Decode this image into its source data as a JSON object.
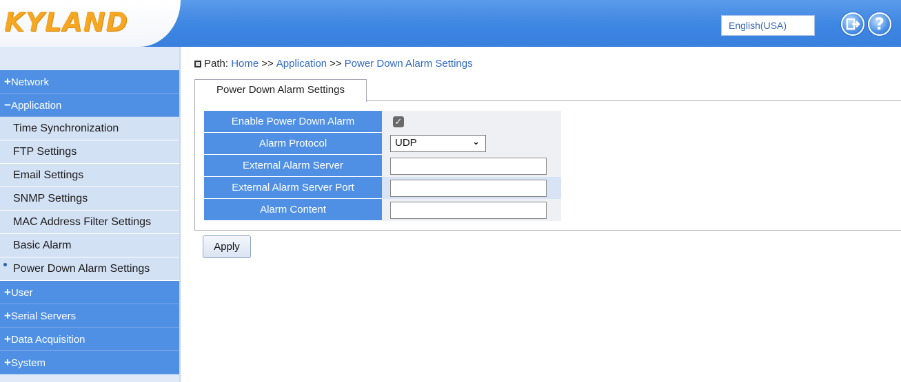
{
  "header": {
    "logo_text": "KYLAND",
    "language": "English(USA)",
    "colors": {
      "header_blue": "#3d86e2",
      "logo_orange": "#f5a623"
    }
  },
  "sidebar": {
    "items": [
      {
        "sign": "+",
        "label": "Network",
        "level": "top"
      },
      {
        "sign": "−",
        "label": "Application",
        "level": "top"
      },
      {
        "label": "Time Synchronization",
        "level": "sub"
      },
      {
        "label": "FTP Settings",
        "level": "sub"
      },
      {
        "label": "Email Settings",
        "level": "sub"
      },
      {
        "label": "SNMP Settings",
        "level": "sub"
      },
      {
        "label": "MAC Address Filter Settings",
        "level": "sub"
      },
      {
        "label": "Basic Alarm",
        "level": "sub"
      },
      {
        "label": "Power Down Alarm Settings",
        "level": "sub",
        "active": true
      },
      {
        "sign": "+",
        "label": "User",
        "level": "top"
      },
      {
        "sign": "+",
        "label": "Serial Servers",
        "level": "top"
      },
      {
        "sign": "+",
        "label": "Data Acquisition",
        "level": "top"
      },
      {
        "sign": "+",
        "label": "System",
        "level": "top"
      }
    ]
  },
  "breadcrumb": {
    "prefix": "Path:",
    "sep": ">>",
    "parts": [
      "Home",
      "Application",
      "Power Down Alarm Settings"
    ]
  },
  "tab": {
    "label": "Power Down Alarm Settings"
  },
  "form": {
    "enable_label": "Enable Power Down Alarm",
    "enable_checked": true,
    "protocol_label": "Alarm Protocol",
    "protocol_value": "UDP",
    "server_label": "External Alarm Server",
    "server_value": "",
    "port_label": "External Alarm Server Port",
    "port_value": "",
    "content_label": "Alarm Content",
    "content_value": ""
  },
  "apply_label": "Apply"
}
